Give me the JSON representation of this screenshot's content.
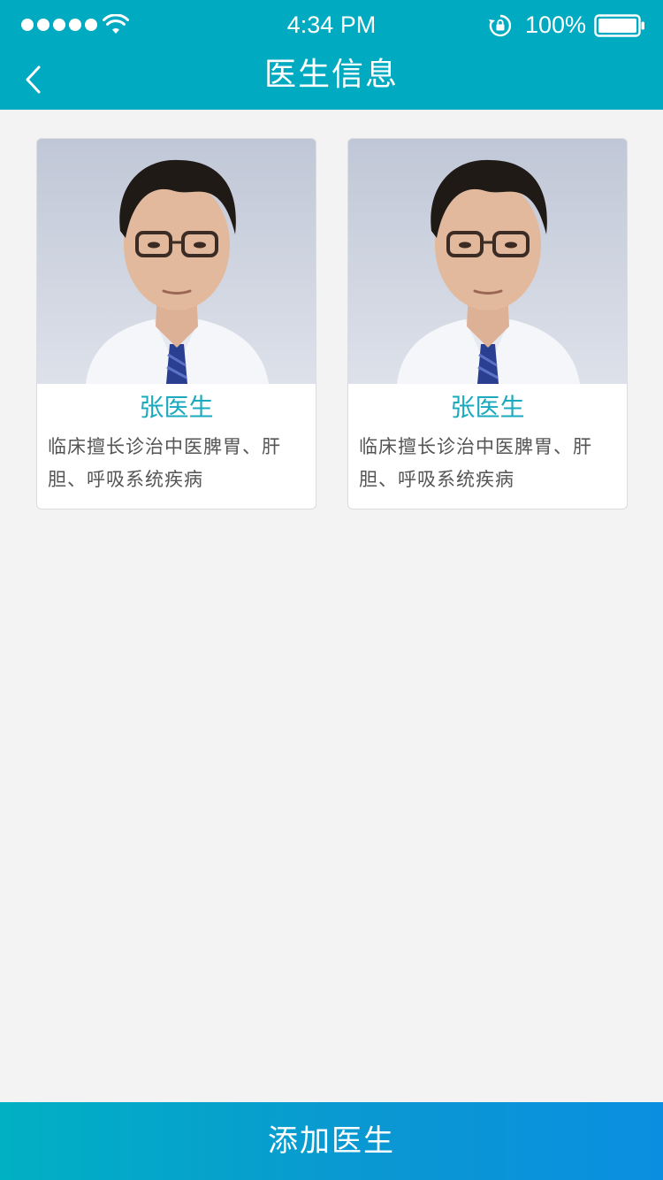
{
  "status_bar": {
    "time": "4:34 PM",
    "battery_percent": "100%",
    "icons": [
      "signal-dots-icon",
      "wifi-icon",
      "rotation-lock-icon",
      "battery-icon"
    ]
  },
  "nav": {
    "back_icon": "chevron-left-icon",
    "title": "医生信息"
  },
  "doctors": [
    {
      "name": "张医生",
      "description": "临床擅长诊治中医脾胃、肝胆、呼吸系统疾病",
      "photo": "doctor-portrait-photo"
    },
    {
      "name": "张医生",
      "description": "临床擅长诊治中医脾胃、肝胆、呼吸系统疾病",
      "photo": "doctor-portrait-photo"
    }
  ],
  "footer": {
    "add_button_label": "添加医生"
  },
  "colors": {
    "primary": "#00abc1",
    "name_text": "#1aa9bd",
    "desc_text": "#555555",
    "background": "#f3f3f3",
    "button_gradient_start": "#00b0c3",
    "button_gradient_end": "#0a8fe0"
  }
}
